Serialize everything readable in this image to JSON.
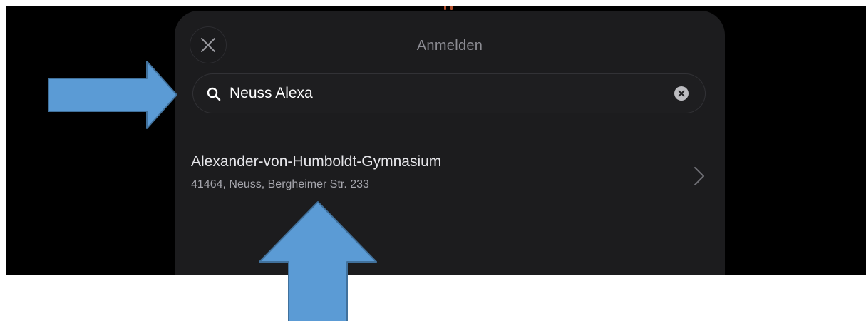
{
  "sheet": {
    "title": "Anmelden",
    "close_icon": "close-icon"
  },
  "search": {
    "value": "Neuss Alexa",
    "icon": "search-icon",
    "clear_icon": "clear-icon"
  },
  "results": [
    {
      "name": "Alexander-von-Humboldt-Gymnasium",
      "address": "41464, Neuss, Bergheimer Str. 233",
      "icon": "chevron-right-icon"
    }
  ],
  "annotations": {
    "color": "#5b9bd5",
    "stroke": "#41719c",
    "arrows": [
      "arrow-right",
      "arrow-up"
    ]
  },
  "colors": {
    "sheet_background": "#1c1c1e",
    "screen_background": "#000000",
    "accent": "#b5502d"
  }
}
